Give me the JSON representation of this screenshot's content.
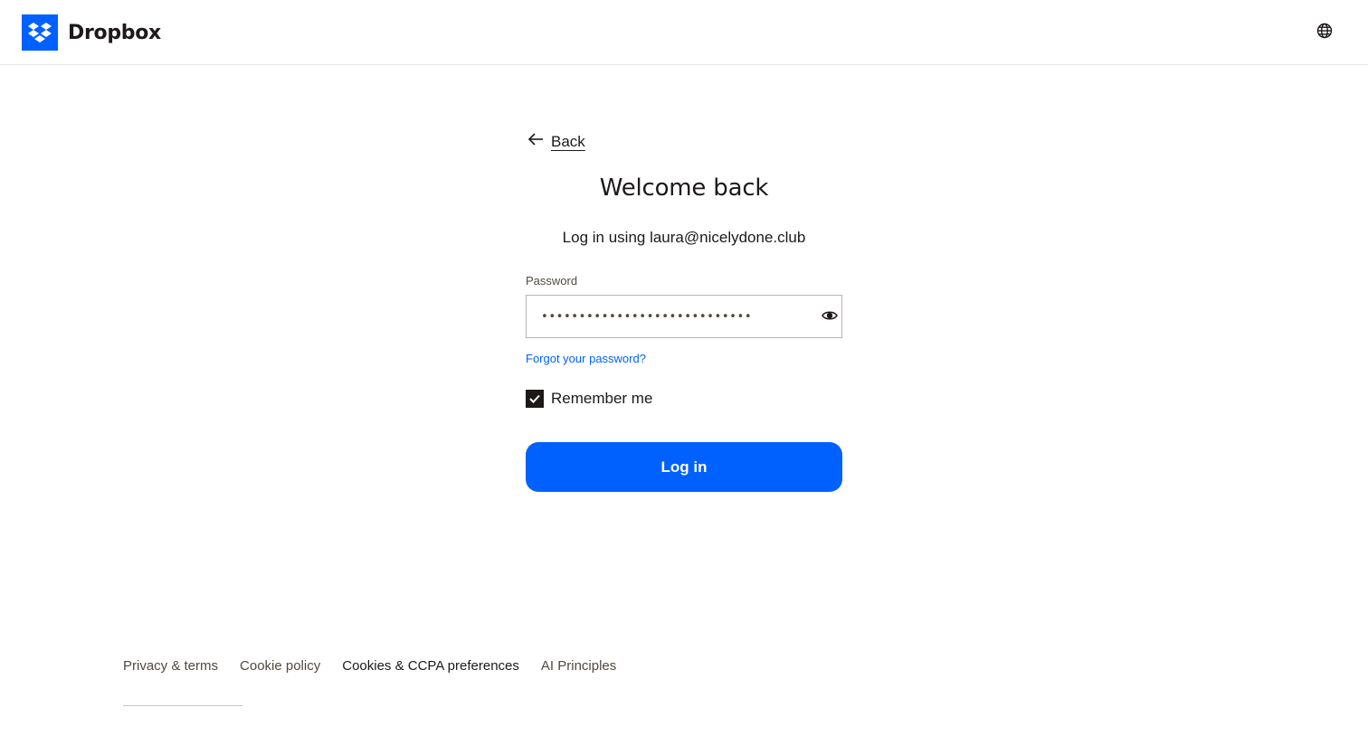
{
  "header": {
    "brand": "Dropbox",
    "brand_color": "#0061fe",
    "logo_icon": "dropbox-logo-icon",
    "language_icon": "globe-icon"
  },
  "login": {
    "back_label": "Back",
    "title": "Welcome back",
    "subtitle": "Log in using laura@nicelydone.club",
    "password_label": "Password",
    "password_value": "••••••••••••••••••••••••••••",
    "show_password_icon": "eye-icon",
    "forgot_link": "Forgot your password?",
    "remember_label": "Remember me",
    "remember_checked": true,
    "submit_label": "Log in"
  },
  "footer": {
    "links": [
      "Privacy & terms",
      "Cookie policy",
      "Cookies & CCPA preferences",
      "AI Principles"
    ]
  },
  "colors": {
    "accent": "#0061fe",
    "text": "#1e1919",
    "muted": "#52493f"
  }
}
